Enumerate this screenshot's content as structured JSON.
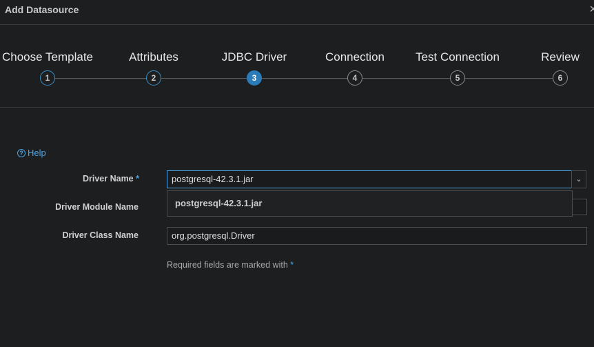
{
  "dialog": {
    "title": "Add Datasource",
    "close_icon": "×"
  },
  "steps": [
    {
      "number": "1",
      "label": "Choose Template",
      "state": "done"
    },
    {
      "number": "2",
      "label": "Attributes",
      "state": "done"
    },
    {
      "number": "3",
      "label": "JDBC Driver",
      "state": "active"
    },
    {
      "number": "4",
      "label": "Connection",
      "state": "pending"
    },
    {
      "number": "5",
      "label": "Test Connection",
      "state": "pending"
    },
    {
      "number": "6",
      "label": "Review",
      "state": "pending"
    }
  ],
  "help": {
    "label": "Help"
  },
  "form": {
    "required_star": "*",
    "driver_name": {
      "label": "Driver Name",
      "value": "postgresql-42.3.1.jar",
      "required": true
    },
    "driver_module": {
      "label": "Driver Module Name",
      "value": ""
    },
    "driver_class": {
      "label": "Driver Class Name",
      "value": "org.postgresql.Driver"
    },
    "dropdown_option": "postgresql-42.3.1.jar",
    "required_note": "Required fields are marked with"
  },
  "colors": {
    "accent": "#4aa6e8",
    "active_step": "#2a7bb8",
    "background": "#1d1e20"
  }
}
